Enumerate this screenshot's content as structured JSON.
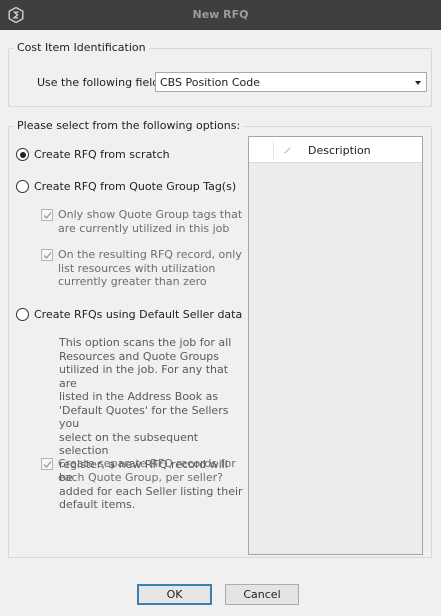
{
  "window": {
    "title": "New RFQ"
  },
  "cost_item_group": {
    "legend": "Cost Item Identification",
    "field_label": "Use the following field:",
    "field_value": "CBS Position Code"
  },
  "options_group": {
    "legend": "Please select from the following options:",
    "radio_scratch": {
      "label": "Create RFQ from scratch",
      "selected": true
    },
    "radio_quote_group": {
      "label": "Create RFQ from Quote Group Tag(s)",
      "selected": false
    },
    "chk_only_show": {
      "line1": "Only show Quote Group tags that",
      "line2": "are currently utilized in this job",
      "checked": true
    },
    "chk_resulting": {
      "line1": "On the resulting RFQ record, only",
      "line2": "list resources with utilization",
      "line3": "currently greater than zero",
      "checked": true
    },
    "radio_default_seller": {
      "label": "Create RFQs using Default Seller data",
      "selected": false
    },
    "default_seller_desc": [
      "This option scans the job for all",
      "Resources and Quote Groups",
      "utilized in the job. For any that are",
      "listed in the Address Book as",
      "'Default Quotes' for the Sellers you",
      "select on the subsequent selection",
      "register, a new RFQ record will be",
      "added for each Seller listing their",
      "default items."
    ],
    "chk_separate": {
      "line1": "Create separate RFQ records for",
      "line2": "each Quote Group, per seller?",
      "checked": true
    }
  },
  "grid": {
    "column_header": "Description",
    "header_icon": "pencil-icon"
  },
  "buttons": {
    "ok": "OK",
    "cancel": "Cancel"
  }
}
